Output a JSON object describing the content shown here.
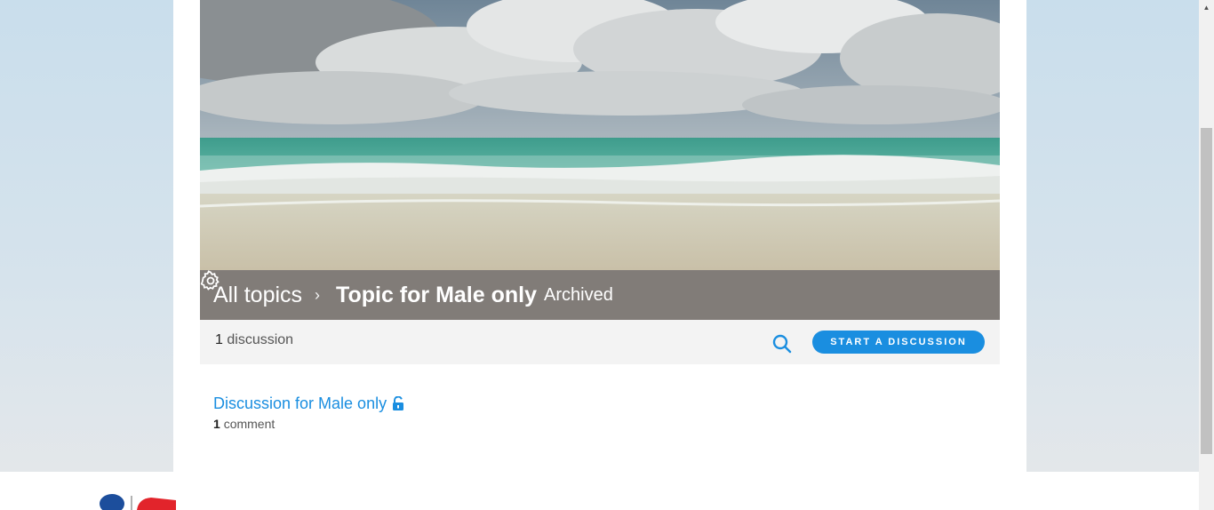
{
  "breadcrumb": {
    "all_topics": "All topics",
    "separator": "›",
    "topic_title": "Topic for Male only",
    "status": "Archived"
  },
  "toolbar": {
    "discussion_count": "1",
    "discussion_label": "discussion",
    "start_button": "START A DISCUSSION"
  },
  "discussions": [
    {
      "title": "Discussion for Male only",
      "comment_count": "1",
      "comment_label": "comment",
      "icon": "unlock-icon"
    }
  ],
  "icons": {
    "settings": "gear-icon",
    "search": "search-icon",
    "scroll_up": "▲"
  },
  "colors": {
    "accent": "#1a8ee0",
    "toolbar_bg": "#f3f3f3",
    "title_bar_bg": "#504a44"
  }
}
